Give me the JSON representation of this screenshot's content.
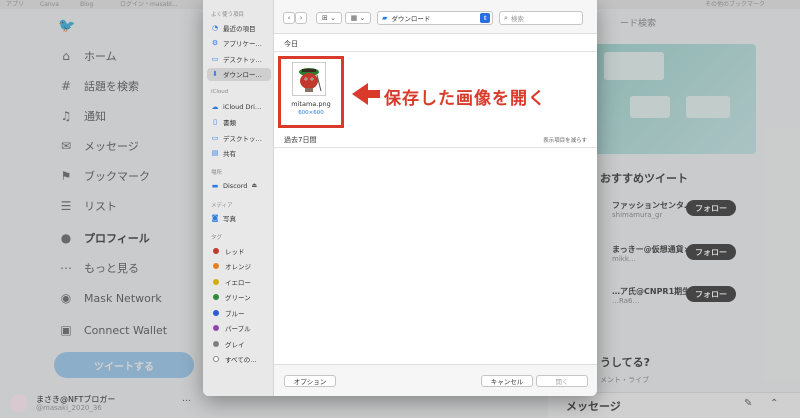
{
  "bookmarks": [
    "アプリ",
    "Canva",
    "Blog",
    "ログイン・masabl…",
    "その他のブックマーク"
  ],
  "twitter_nav": {
    "items": [
      {
        "label": "ホーム",
        "icon": "home-icon",
        "glyph": "⌂"
      },
      {
        "label": "話題を検索",
        "icon": "hashtag-icon",
        "glyph": "#"
      },
      {
        "label": "通知",
        "icon": "bell-icon",
        "glyph": "♫"
      },
      {
        "label": "メッセージ",
        "icon": "mail-icon",
        "glyph": "✉"
      },
      {
        "label": "ブックマーク",
        "icon": "bookmark-icon",
        "glyph": "⚑"
      },
      {
        "label": "リスト",
        "icon": "list-icon",
        "glyph": "☰"
      },
      {
        "label": "プロフィール",
        "icon": "person-icon",
        "glyph": "●"
      },
      {
        "label": "もっと見る",
        "icon": "more-circle-icon",
        "glyph": "⋯"
      },
      {
        "label": "Mask Network",
        "icon": "mask-network-icon",
        "glyph": "◉"
      },
      {
        "label": "Connect Wallet",
        "icon": "wallet-icon",
        "glyph": "▣"
      }
    ],
    "tweet_button": "ツイートする",
    "profile": {
      "name": "まさき@NFTブロガー",
      "handle": "@masaki_2020_36",
      "more": "…"
    }
  },
  "twitter_right": {
    "search_placeholder": "ード検索",
    "heading": "おすすめツイート",
    "users": [
      {
        "name": "ファッションセンタ…",
        "handle": "shimamura_gr",
        "follow": "フォロー"
      },
      {
        "name": "まっきー@仮想通貨×P…",
        "handle": "mikk…",
        "follow": "フォロー"
      },
      {
        "name": "…ア氏@CNPR1期生",
        "handle": "…Ra6…",
        "follow": "フォロー"
      }
    ],
    "whats_happening": "うしてる?",
    "trend": "メント・ライブ",
    "messages": "メッセージ"
  },
  "dialog": {
    "sidebar": {
      "favorites_head": "よく使う項目",
      "favorites": [
        {
          "label": "最近の項目",
          "icon": "clock-icon",
          "glyph": "◔"
        },
        {
          "label": "アプリケー…",
          "icon": "apps-icon",
          "glyph": "⚙"
        },
        {
          "label": "デスクトッ…",
          "icon": "desktop-icon",
          "glyph": "▭"
        },
        {
          "label": "ダウンロー…",
          "icon": "download-icon",
          "glyph": "⬇",
          "selected": true
        }
      ],
      "icloud_head": "iCloud",
      "icloud": [
        {
          "label": "iCloud Dri…",
          "icon": "cloud-icon",
          "glyph": "☁"
        },
        {
          "label": "書類",
          "icon": "document-icon",
          "glyph": "▯"
        },
        {
          "label": "デスクトッ…",
          "icon": "desktop-icon",
          "glyph": "▭"
        },
        {
          "label": "共有",
          "icon": "shared-folder-icon",
          "glyph": "▤"
        }
      ],
      "locations_head": "場所",
      "locations": [
        {
          "label": "Discord",
          "icon": "disk-icon",
          "glyph": "▬",
          "eject": "⏏"
        }
      ],
      "media_head": "メディア",
      "media": [
        {
          "label": "写真",
          "icon": "camera-icon",
          "glyph": "◙"
        }
      ],
      "tags_head": "タグ",
      "tags": [
        {
          "label": "レッド",
          "color": "#c0392b"
        },
        {
          "label": "オレンジ",
          "color": "#e67e22"
        },
        {
          "label": "イエロー",
          "color": "#d4ac0d"
        },
        {
          "label": "グリーン",
          "color": "#2e8b3a"
        },
        {
          "label": "ブルー",
          "color": "#2a5bd7"
        },
        {
          "label": "パープル",
          "color": "#8e44ad"
        },
        {
          "label": "グレイ",
          "color": "#7f7f7f"
        },
        {
          "label": "すべての…",
          "color": "#ffffff"
        }
      ]
    },
    "toolbar": {
      "back": "‹",
      "forward": "›",
      "view_grid": "⊞ ⌄",
      "view_group": "▦ ⌄",
      "location": "ダウンロード",
      "search_placeholder": "検索"
    },
    "today_label": "今日",
    "file": {
      "name": "mitama.png",
      "dimensions": "600×600"
    },
    "annotation": "保存した画像を開く",
    "past_label": "過去7日間",
    "show_items": "表示項目を減らす",
    "footer": {
      "options": "オプション",
      "cancel": "キャンセル",
      "open": "開く"
    }
  }
}
